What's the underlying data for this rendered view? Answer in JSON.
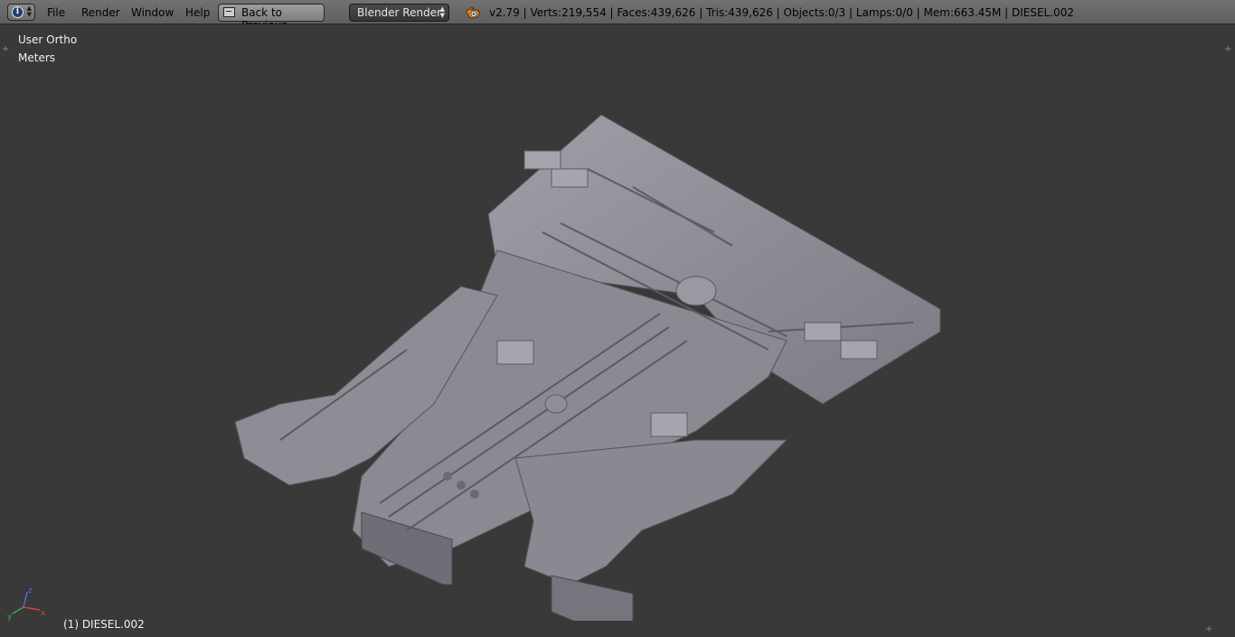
{
  "header": {
    "editor_type_icon": "info-icon",
    "menu": [
      {
        "label": "File"
      },
      {
        "label": "Render"
      },
      {
        "label": "Window"
      },
      {
        "label": "Help"
      }
    ],
    "back_button_label": "Back to Previous",
    "render_engine": "Blender Render",
    "stats": "v2.79 | Verts:219,554 | Faces:439,626 | Tris:439,626 | Objects:0/3 | Lamps:0/0 | Mem:663.45M | DIESEL.002"
  },
  "viewport": {
    "view_name": "User Ortho",
    "units": "Meters",
    "object_label": "(1) DIESEL.002",
    "model_color": "#8e8c94",
    "background_color": "#393939"
  }
}
